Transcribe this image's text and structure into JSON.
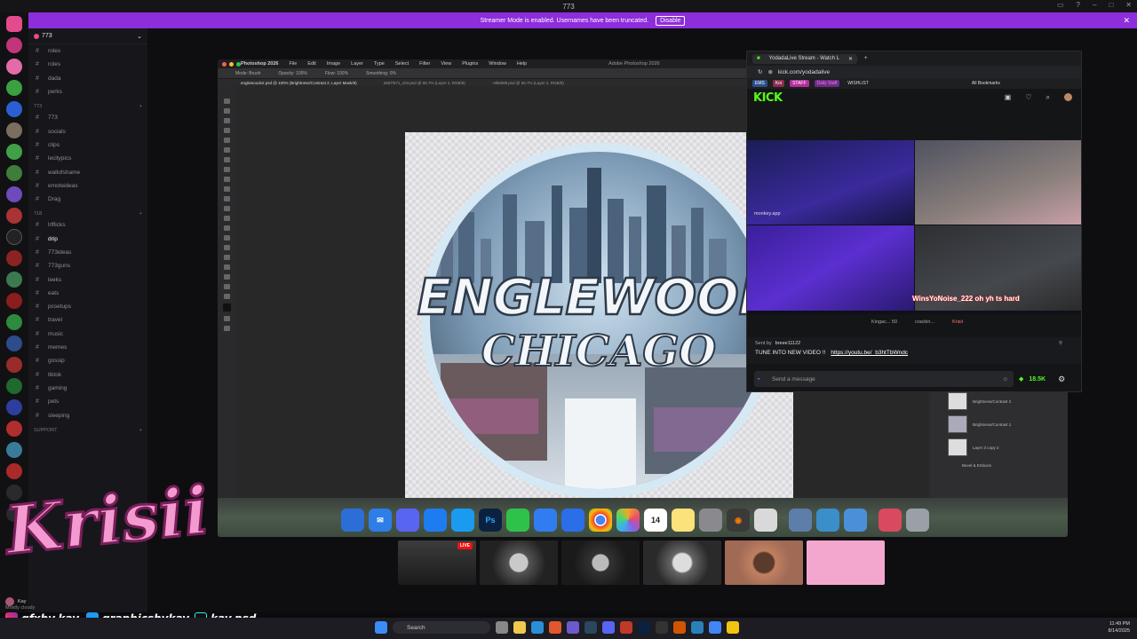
{
  "window": {
    "title": "773"
  },
  "streamer_banner": {
    "text": "Streamer Mode is enabled. Usernames have been truncated.",
    "button": "Disable"
  },
  "discord": {
    "server_name": "773",
    "channels": [
      {
        "type": "channel",
        "label": "roles"
      },
      {
        "type": "channel",
        "label": "roles"
      },
      {
        "type": "channel",
        "label": "dada"
      },
      {
        "type": "channel",
        "label": "perks"
      },
      {
        "type": "category",
        "label": "773"
      },
      {
        "type": "channel",
        "label": "773"
      },
      {
        "type": "channel",
        "label": "socials"
      },
      {
        "type": "channel",
        "label": "clips"
      },
      {
        "type": "channel",
        "label": "lecitypics"
      },
      {
        "type": "channel",
        "label": "wallofshame"
      },
      {
        "type": "channel",
        "label": "emoteideas"
      },
      {
        "type": "channel",
        "label": "Drag"
      },
      {
        "type": "category",
        "label": "718"
      },
      {
        "type": "channel",
        "label": "lrlflicks"
      },
      {
        "type": "channel",
        "label": "drip",
        "active": true
      },
      {
        "type": "channel",
        "label": "773ideas"
      },
      {
        "type": "channel",
        "label": "773guns"
      },
      {
        "type": "channel",
        "label": "leeks"
      },
      {
        "type": "channel",
        "label": "eats"
      },
      {
        "type": "channel",
        "label": "pcsetups"
      },
      {
        "type": "channel",
        "label": "travel"
      },
      {
        "type": "channel",
        "label": "music"
      },
      {
        "type": "channel",
        "label": "memes"
      },
      {
        "type": "channel",
        "label": "gossip"
      },
      {
        "type": "channel",
        "label": "tiktok"
      },
      {
        "type": "channel",
        "label": "gaming"
      },
      {
        "type": "channel",
        "label": "pets"
      },
      {
        "type": "channel",
        "label": "sleeping"
      },
      {
        "type": "category",
        "label": "SUPPORT"
      }
    ],
    "user": {
      "name": "Kay",
      "status": "Mostly cloudy"
    }
  },
  "photoshop": {
    "menu": [
      "Photoshop 2026",
      "File",
      "Edit",
      "Image",
      "Layer",
      "Type",
      "Select",
      "Filter",
      "View",
      "Plugins",
      "Window",
      "Help"
    ],
    "app_title": "Adobe Photoshop 2026",
    "options": {
      "mode": "Mode: Brush",
      "opacity": "Opacity: 100%",
      "flow": "Flow: 100%",
      "smoothing": "Smoothing: 0%"
    },
    "tabs": [
      "englewoodv2.psd @ 100% (Brightness/Contrast 2, Layer Mask/8)",
      "2687/671_v04.psd @ 66.7% (Layer 2, RGB/8)",
      "~8k6999.psd @ 66.7% (Layer 2, RGB/8)"
    ],
    "artwork": {
      "line1": "ENGLEWOOD",
      "line2": "CHICAGO"
    },
    "layers": [
      "Brightness/Contrast 2",
      "Brightness/Contrast 1",
      "Layer 3 copy 2",
      "Bevel & Emboss"
    ]
  },
  "kick": {
    "tab_title": "YodadaLive Stream - Watch L",
    "url": "kick.com/yodadalive",
    "bookmarks": [
      "EMS",
      "Koi",
      "STAFF",
      "Daily Staff",
      "WISHLIST"
    ],
    "all_bookmarks": "All Bookmarks",
    "logo": "KICK",
    "cam_label": "monkey.app",
    "chat_overlay": "WinsYoNoise_222 oh yh ts hard",
    "recent_chatters": [
      "Kingac... 50",
      "crackin...",
      "Krisii"
    ],
    "pinned": {
      "sent_by": "Sent by",
      "sender": "breee11122",
      "message": "TUNE INTO NEW VIDEO !!",
      "link": "https://youtu.be/_b3htTbWndc"
    },
    "input_placeholder": "Send a message",
    "viewer_count": "18.5K",
    "colors": {
      "accent": "#53fc18"
    }
  },
  "dock": [
    "finder-icon",
    "mail-icon",
    "discord-icon",
    "app-store-icon",
    "safari-icon",
    "photoshop-icon",
    "messages-icon",
    "notes-icon",
    "zoom-icon",
    "chrome-icon",
    "photos-icon",
    "calendar-icon",
    "notes-yellow-icon",
    "settings-icon",
    "blender-icon",
    "scripts-icon",
    "preview-icon",
    "network-icon",
    "pages-icon",
    "gift-icon",
    "trash-icon"
  ],
  "dock_labels": {
    "calendar": "14",
    "photoshop": "Ps"
  },
  "thumbnails": {
    "live_badge": "LIVE"
  },
  "branding": {
    "name": "Krisii",
    "instagram": "gfxby.kay",
    "twitter": "graphicsbykay",
    "tiktok": "kay.psd"
  },
  "taskbar": {
    "search_placeholder": "Search",
    "time": "11:49 PM",
    "date": "8/14/2025"
  }
}
